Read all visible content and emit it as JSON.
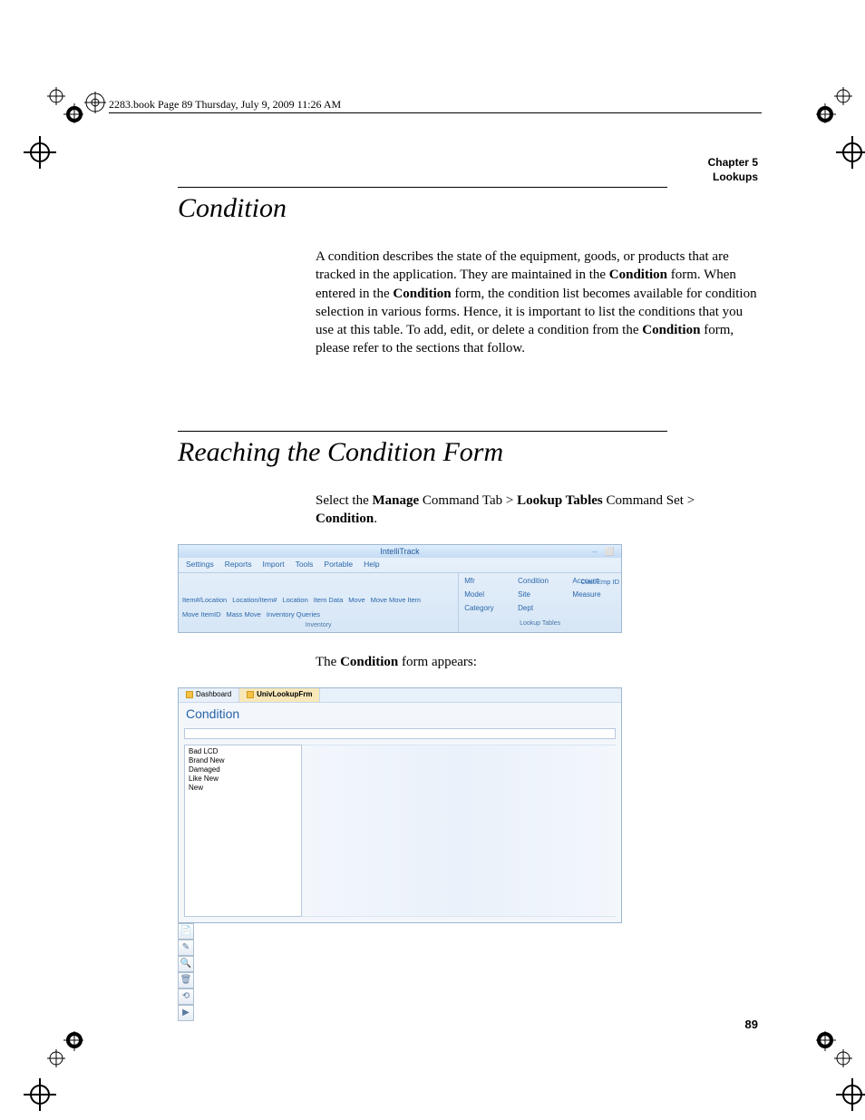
{
  "slug": "2283.book  Page 89  Thursday, July 9, 2009  11:26 AM",
  "chapter": {
    "line1": "Chapter 5",
    "line2": "Lookups"
  },
  "section1": {
    "title": "Condition",
    "para": "A condition describes the state of the equipment, goods, or products that are tracked in the application. They are maintained in the ",
    "para_b1": "Condition",
    "para2": " form. When entered in the ",
    "para_b2": "Condition",
    "para3": " form, the condition list becomes available for condition selection in various forms. Hence, it is important to list the conditions that you use at this table. To add, edit, or delete a condition from the ",
    "para_b3": "Condition",
    "para4": " form, please refer to the sections that follow."
  },
  "section2": {
    "title": "Reaching the Condition Form",
    "lead1": "Select the ",
    "lead_b1": "Manage",
    "lead2": " Command Tab > ",
    "lead_b2": "Lookup Tables",
    "lead3": " Command Set > ",
    "lead_b3": "Condition",
    "lead4": ".",
    "after_ribbon1": "The ",
    "after_ribbon_b": "Condition",
    "after_ribbon2": " form appears:"
  },
  "ribbon": {
    "title": "IntelliTrack",
    "tabs": [
      "Settings",
      "Reports",
      "Import",
      "Tools",
      "Portable",
      "Help"
    ],
    "inventory": {
      "items": [
        "Item#/Location",
        "Location/Item#",
        "Location",
        "Item Data",
        "Move",
        "Move Move Item",
        "Move ItemID",
        "Mass Move",
        "Inventory Queries"
      ],
      "name": "Inventory"
    },
    "lookup": {
      "grid": [
        [
          "Mfr",
          "Condition",
          "Account"
        ],
        [
          "Model",
          "Site",
          "Measure"
        ],
        [
          "Category",
          "Dept",
          ""
        ]
      ],
      "edge": "Cust/Emp ID",
      "name": "Lookup Tables"
    }
  },
  "condform": {
    "tabs": {
      "dashboard": "Dashboard",
      "active": "UnivLookupFrm"
    },
    "title": "Condition",
    "items": [
      "Bad LCD",
      "Brand New",
      "Damaged",
      "Like New",
      "New"
    ],
    "toolbar_icons": [
      "📄",
      "✎",
      "🔍",
      "🗑",
      "⟲",
      "▶"
    ]
  },
  "page_number": "89"
}
